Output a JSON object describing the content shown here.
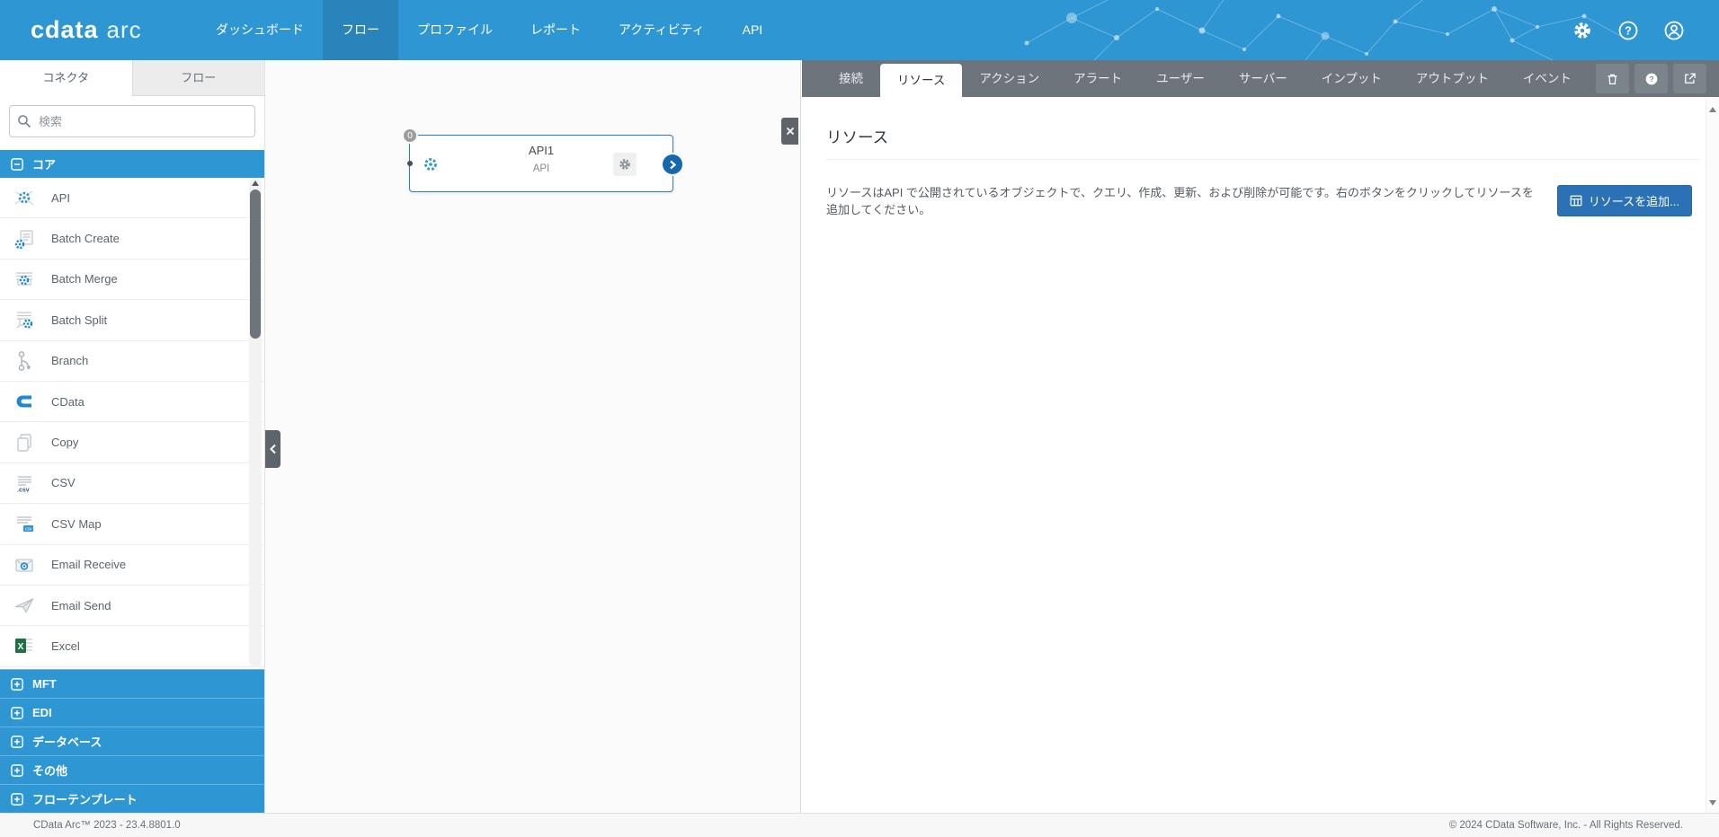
{
  "navbar": {
    "logo_primary": "cdata",
    "logo_secondary": "arc",
    "items": [
      {
        "label": "ダッシュボード",
        "active": false
      },
      {
        "label": "フロー",
        "active": true
      },
      {
        "label": "プロファイル",
        "active": false
      },
      {
        "label": "レポート",
        "active": false
      },
      {
        "label": "アクティビティ",
        "active": false
      },
      {
        "label": "API",
        "active": false
      }
    ],
    "icons": [
      {
        "name": "gear-icon"
      },
      {
        "name": "help-icon"
      },
      {
        "name": "user-icon"
      }
    ]
  },
  "sidebar": {
    "tabs": [
      {
        "label": "コネクタ",
        "active": true
      },
      {
        "label": "フロー",
        "active": false
      }
    ],
    "search": {
      "placeholder": "検索"
    },
    "core_section": {
      "label": "コア"
    },
    "connectors": [
      {
        "name": "API",
        "icon": "api-icon"
      },
      {
        "name": "Batch Create",
        "icon": "batch-create-icon"
      },
      {
        "name": "Batch Merge",
        "icon": "batch-merge-icon"
      },
      {
        "name": "Batch Split",
        "icon": "batch-split-icon"
      },
      {
        "name": "Branch",
        "icon": "branch-icon"
      },
      {
        "name": "CData",
        "icon": "cdata-icon"
      },
      {
        "name": "Copy",
        "icon": "copy-icon"
      },
      {
        "name": "CSV",
        "icon": "csv-icon"
      },
      {
        "name": "CSV Map",
        "icon": "csv-map-icon"
      },
      {
        "name": "Email Receive",
        "icon": "email-receive-icon"
      },
      {
        "name": "Email Send",
        "icon": "email-send-icon"
      },
      {
        "name": "Excel",
        "icon": "excel-icon"
      }
    ],
    "categories": [
      {
        "label": "MFT"
      },
      {
        "label": "EDI"
      },
      {
        "label": "データベース"
      },
      {
        "label": "その他"
      },
      {
        "label": "フローテンプレート"
      }
    ]
  },
  "canvas": {
    "node": {
      "badge": "0",
      "title": "API1",
      "subtitle": "API"
    }
  },
  "panel": {
    "tabs": [
      {
        "label": "接続",
        "active": false
      },
      {
        "label": "リソース",
        "active": true
      },
      {
        "label": "アクション",
        "active": false
      },
      {
        "label": "アラート",
        "active": false
      },
      {
        "label": "ユーザー",
        "active": false
      },
      {
        "label": "サーバー",
        "active": false
      },
      {
        "label": "インプット",
        "active": false
      },
      {
        "label": "アウトプット",
        "active": false
      },
      {
        "label": "イベント",
        "active": false
      }
    ],
    "tools": [
      {
        "name": "trash-icon"
      },
      {
        "name": "help-icon"
      },
      {
        "name": "external-link-icon"
      }
    ],
    "heading": "リソース",
    "description": "リソースはAPI で公開されているオブジェクトで、クエリ、作成、更新、および削除が可能です。右のボタンをクリックしてリソースを追加してください。",
    "add_button_label": "リソースを追加..."
  },
  "footer": {
    "left": "CData Arc™ 2023 - 23.4.8801.0",
    "right": "© 2024 CData Software, Inc. - All Rights Reserved."
  },
  "colors": {
    "navbar": "#2E96D3",
    "navbar_active": "#2A84BC",
    "sidebar_category": "#2E96D3",
    "panel_tabbar": "#6D747B",
    "primary_button": "#2A72B5",
    "node_border": "#2B7FC0"
  }
}
